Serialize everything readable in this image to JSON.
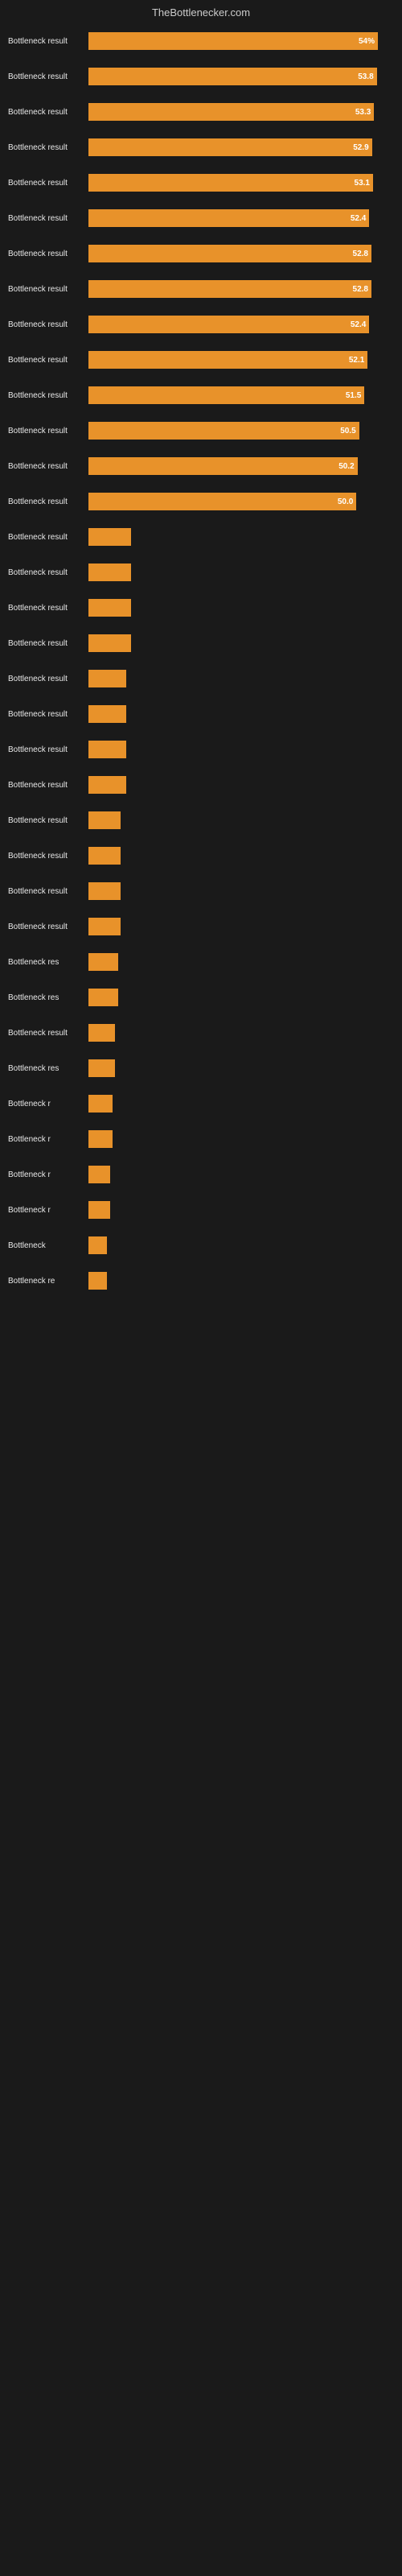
{
  "header": {
    "title": "TheBottlenecker.com"
  },
  "bars": [
    {
      "label": "Bottleneck result",
      "value": 54.0,
      "display": "54%",
      "width_pct": 54
    },
    {
      "label": "Bottleneck result",
      "value": 53.8,
      "display": "53.8",
      "width_pct": 53.8
    },
    {
      "label": "Bottleneck result",
      "value": 53.3,
      "display": "53.3",
      "width_pct": 53.3
    },
    {
      "label": "Bottleneck result",
      "value": 52.9,
      "display": "52.9",
      "width_pct": 52.9
    },
    {
      "label": "Bottleneck result",
      "value": 53.1,
      "display": "53.1",
      "width_pct": 53.1
    },
    {
      "label": "Bottleneck result",
      "value": 52.4,
      "display": "52.4",
      "width_pct": 52.4
    },
    {
      "label": "Bottleneck result",
      "value": 52.8,
      "display": "52.8",
      "width_pct": 52.8
    },
    {
      "label": "Bottleneck result",
      "value": 52.8,
      "display": "52.8",
      "width_pct": 52.8
    },
    {
      "label": "Bottleneck result",
      "value": 52.4,
      "display": "52.4",
      "width_pct": 52.4
    },
    {
      "label": "Bottleneck result",
      "value": 52.1,
      "display": "52.1",
      "width_pct": 52.1
    },
    {
      "label": "Bottleneck result",
      "value": 51.5,
      "display": "51.5",
      "width_pct": 51.5
    },
    {
      "label": "Bottleneck result",
      "value": 50.5,
      "display": "50.5",
      "width_pct": 50.5
    },
    {
      "label": "Bottleneck result",
      "value": 50.2,
      "display": "50.2",
      "width_pct": 50.2
    },
    {
      "label": "Bottleneck result",
      "value": 50.0,
      "display": "50.0",
      "width_pct": 50.0
    },
    {
      "label": "Bottleneck result",
      "value": 8,
      "display": "",
      "width_pct": 8
    },
    {
      "label": "Bottleneck result",
      "value": 8,
      "display": "",
      "width_pct": 8
    },
    {
      "label": "Bottleneck result",
      "value": 8,
      "display": "",
      "width_pct": 8
    },
    {
      "label": "Bottleneck result",
      "value": 8,
      "display": "",
      "width_pct": 8
    },
    {
      "label": "Bottleneck result",
      "value": 7,
      "display": "",
      "width_pct": 7
    },
    {
      "label": "Bottleneck result",
      "value": 7,
      "display": "",
      "width_pct": 7
    },
    {
      "label": "Bottleneck result",
      "value": 7,
      "display": "",
      "width_pct": 7
    },
    {
      "label": "Bottleneck result",
      "value": 7,
      "display": "",
      "width_pct": 7
    },
    {
      "label": "Bottleneck result",
      "value": 6,
      "display": "",
      "width_pct": 6
    },
    {
      "label": "Bottleneck result",
      "value": 6,
      "display": "",
      "width_pct": 6
    },
    {
      "label": "Bottleneck result",
      "value": 6,
      "display": "",
      "width_pct": 6
    },
    {
      "label": "Bottleneck result",
      "value": 6,
      "display": "",
      "width_pct": 6
    },
    {
      "label": "Bottleneck res",
      "value": 5.5,
      "display": "",
      "width_pct": 5.5
    },
    {
      "label": "Bottleneck res",
      "value": 5.5,
      "display": "",
      "width_pct": 5.5
    },
    {
      "label": "Bottleneck result",
      "value": 5,
      "display": "",
      "width_pct": 5
    },
    {
      "label": "Bottleneck res",
      "value": 5,
      "display": "",
      "width_pct": 5
    },
    {
      "label": "Bottleneck r",
      "value": 4.5,
      "display": "",
      "width_pct": 4.5
    },
    {
      "label": "Bottleneck r",
      "value": 4.5,
      "display": "",
      "width_pct": 4.5
    },
    {
      "label": "Bottleneck r",
      "value": 4,
      "display": "",
      "width_pct": 4
    },
    {
      "label": "Bottleneck r",
      "value": 4,
      "display": "",
      "width_pct": 4
    },
    {
      "label": "Bottleneck",
      "value": 3.5,
      "display": "",
      "width_pct": 3.5
    },
    {
      "label": "Bottleneck re",
      "value": 3.5,
      "display": "",
      "width_pct": 3.5
    }
  ]
}
